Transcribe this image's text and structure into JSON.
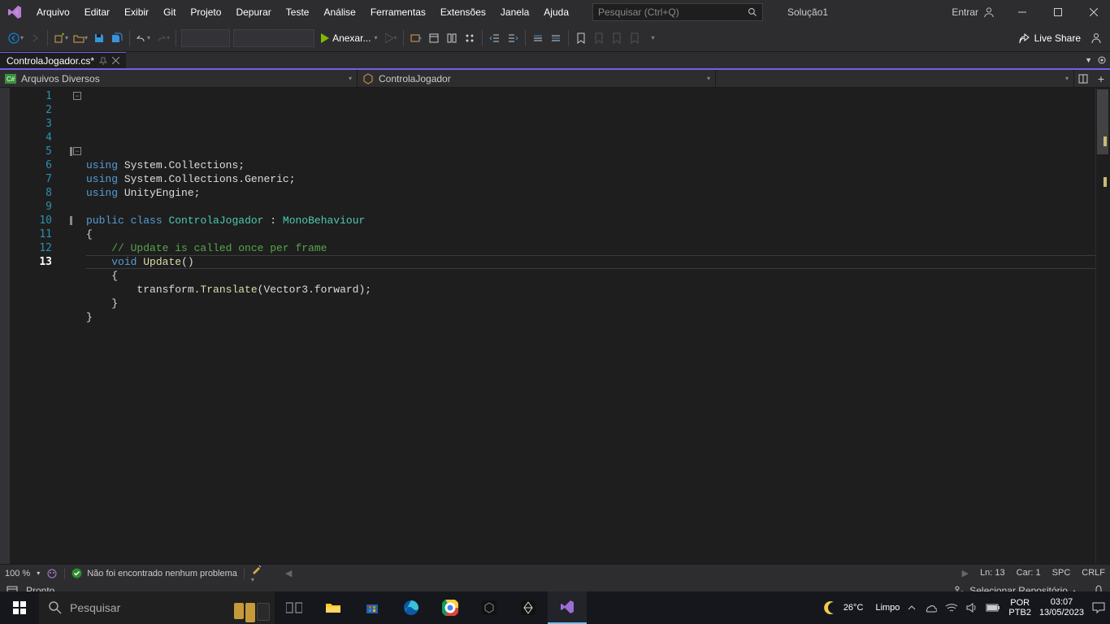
{
  "menu": [
    "Arquivo",
    "Editar",
    "Exibir",
    "Git",
    "Projeto",
    "Depurar",
    "Teste",
    "Análise",
    "Ferramentas",
    "Extensões",
    "Janela",
    "Ajuda"
  ],
  "search_placeholder": "Pesquisar (Ctrl+Q)",
  "solution": "Solução1",
  "signin": "Entrar",
  "run_label": "Anexar...",
  "live_share": "Live Share",
  "tab": {
    "name": "ControlaJogador.cs*",
    "modified": true
  },
  "nav": {
    "left": "Arquivos Diversos",
    "mid": "ControlaJogador",
    "right": ""
  },
  "code": {
    "lines": [
      {
        "n": 1,
        "html": "<span class='kw'>using</span> <span class='pln'>System</span>.<span class='pln'>Collections</span>;"
      },
      {
        "n": 2,
        "html": "<span class='kw'>using</span> <span class='pln'>System</span>.<span class='pln'>Collections</span>.<span class='pln'>Generic</span>;"
      },
      {
        "n": 3,
        "html": "<span class='kw'>using</span> <span class='pln'>UnityEngine</span>;"
      },
      {
        "n": 4,
        "html": ""
      },
      {
        "n": 5,
        "html": "<span class='kw'>public</span> <span class='kw'>class</span> <span class='cls'>ControlaJogador</span> : <span class='cls'>MonoBehaviour</span>"
      },
      {
        "n": 6,
        "html": "{"
      },
      {
        "n": 7,
        "html": "    <span class='cmt'>// Update is called once per frame</span>"
      },
      {
        "n": 8,
        "html": "    <span class='kw'>void</span> <span class='meth'>Update</span>()"
      },
      {
        "n": 9,
        "html": "    {"
      },
      {
        "n": 10,
        "html": "        transform.<span class='meth'>Translate</span>(<span class='pln'>Vector3</span>.forward);"
      },
      {
        "n": 11,
        "html": "    }"
      },
      {
        "n": 12,
        "html": "}"
      },
      {
        "n": 13,
        "html": ""
      }
    ],
    "current_line": 13
  },
  "editor_bottom": {
    "zoom": "100 %",
    "problems": "Não foi encontrado nenhum problema",
    "pos_ln_label": "Ln:",
    "pos_ln": "13",
    "pos_col_label": "Car:",
    "pos_col": "1",
    "ind": "SPC",
    "eol": "CRLF"
  },
  "status": {
    "ready": "Pronto",
    "repo": "Selecionar Repositório"
  },
  "taskbar": {
    "search_placeholder": "Pesquisar",
    "weather_temp": "26°C",
    "weather_desc": "Limpo",
    "lang1": "POR",
    "lang2": "PTB2",
    "time": "03:07",
    "date": "13/05/2023"
  }
}
